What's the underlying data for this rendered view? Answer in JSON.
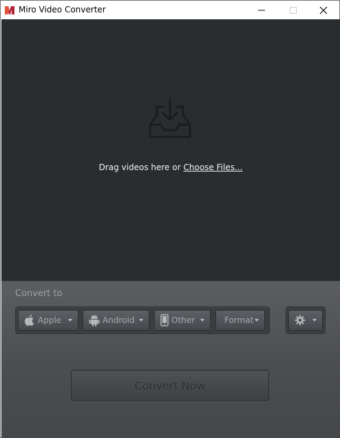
{
  "window": {
    "title": "Miro Video Converter",
    "icon": "miro-logo-icon"
  },
  "drop_area": {
    "prompt": "Drag videos here or",
    "choose_files": "Choose Files...",
    "icon": "download-tray-icon"
  },
  "convert_panel": {
    "convert_to_label": "Convert to",
    "targets": [
      {
        "label": "Apple",
        "icon": "apple-icon"
      },
      {
        "label": "Android",
        "icon": "android-icon"
      },
      {
        "label": "Other",
        "icon": "phone-icon"
      },
      {
        "label": "Format",
        "icon": ""
      }
    ],
    "settings_icon": "gear-icon",
    "convert_now": "Convert Now"
  },
  "colors": {
    "drop_bg": "#2a2d30",
    "panel_bg": "#4a4d50"
  }
}
